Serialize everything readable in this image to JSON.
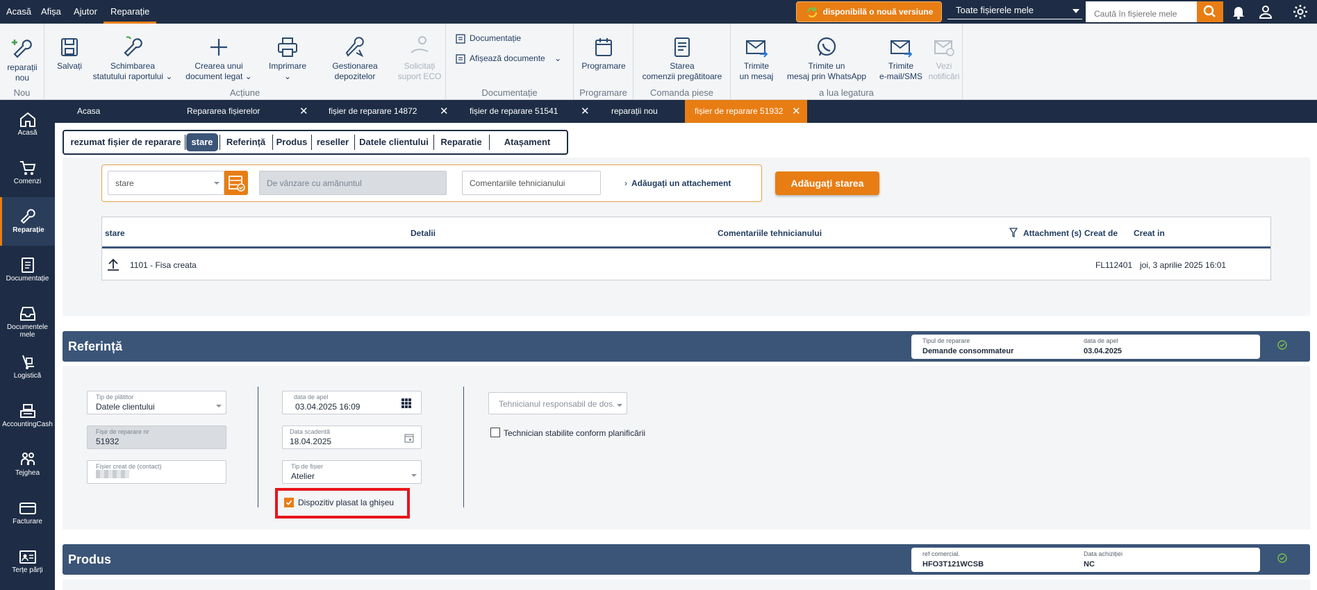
{
  "topmenu": {
    "items": [
      "Acasă",
      "Afișa",
      "Ajutor",
      "Reparație"
    ],
    "active": "Reparație",
    "update_label": "disponibilă o nouă versiune",
    "scope_select": "Toate fișierele mele",
    "search_placeholder": "Caută în fișierele mele"
  },
  "ribbon": {
    "nou": {
      "btn": [
        "reparații",
        "nou"
      ],
      "label": "Nou"
    },
    "actiune": {
      "salvati": "Salvați",
      "schimbare": [
        "Schimbarea",
        "statutului raportului"
      ],
      "creare": [
        "Crearea unui",
        "document legat"
      ],
      "imprimare": "Imprimare",
      "gestionare": [
        "Gestionarea",
        "depozitelor"
      ],
      "solicitati": [
        "Solicitați",
        "suport ECO"
      ],
      "label": "Acțiune"
    },
    "documentatie": {
      "btn1": "Documentație",
      "btn2": "Afișează documente",
      "label": "Documentație"
    },
    "programare": {
      "btn": "Programare",
      "label": "Programare"
    },
    "comanda": {
      "btn": [
        "Starea",
        "comenzii pregătitoare"
      ],
      "label": "Comanda piese"
    },
    "legatura": {
      "mesaj": [
        "Trimite",
        "un mesaj"
      ],
      "whatsapp": [
        "Trimite un",
        "mesaj prin WhatsApp"
      ],
      "email": [
        "Trimite",
        "e-mail/SMS"
      ],
      "notificari": [
        "Vezi",
        "notificări"
      ],
      "label": "a lua legatura"
    }
  },
  "leftnav": [
    "Acasă",
    "Comenzi",
    "Reparație",
    "Documentație",
    "Documentele mele",
    "Logistică",
    "AccountingCash",
    "Tejghea",
    "Facturare",
    "Terțe părți"
  ],
  "doctabs": [
    "Acasa",
    "Repararea fișierelor",
    "fișier de reparare 14872",
    "fișier de reparare 51541",
    "reparații nou",
    "fișier de reparare 51932"
  ],
  "subtabs": [
    "rezumat fișier de reparare",
    "stare",
    "Referință",
    "Produs",
    "reseller",
    "Datele clientului",
    "Reparatie",
    "Atașament"
  ],
  "stare": {
    "select_placeholder": "stare",
    "retail_placeholder": "De vânzare cu amănuntul",
    "comments_placeholder": "Comentariile tehnicianului",
    "attach_label": "Adăugați un attachement",
    "add_button": "Adăugați starea",
    "columns": [
      "stare",
      "Detalii",
      "Comentariile tehnicianului",
      "Attachment (s)",
      "Creat de",
      "Creat in"
    ],
    "row": {
      "stare": "1101 - Fisa creata",
      "creat_de": "FL112401",
      "creat_in": "joi, 3 aprilie 2025 16:01"
    }
  },
  "referinta": {
    "title": "Referință",
    "card": {
      "l1": "Tipul de reparare",
      "v1": "Demande consommateur",
      "l2": "data de apel",
      "v2": "03.04.2025"
    },
    "tip_platitor": {
      "label": "Tip de plătitor",
      "value": "Datele clientului"
    },
    "fisa_nr": {
      "label": "Fișe de reparare nr",
      "value": "51932"
    },
    "fisier_creat": {
      "label": "Fișier creat de (contact)"
    },
    "data_apel": {
      "label": "data de apel",
      "value": "03.04.2025 16:09"
    },
    "data_scadenta": {
      "label": "Data scadentă",
      "value": "18.04.2025"
    },
    "tip_fisier": {
      "label": "Tip de fișier",
      "value": "Atelier"
    },
    "dispozitiv": "Dispozitiv plasat la ghișeu",
    "tehnician_placeholder": "Tehnicianul responsabil de dos...",
    "tehnician_check": "Technician stabilite conform planificării"
  },
  "produs": {
    "title": "Produs",
    "card": {
      "l1": "ref comercial.",
      "v1": "HFO3T121WCSB",
      "l2": "Data achiziției",
      "v2": "NC"
    }
  },
  "colors": {
    "navy": "#1e2d45",
    "orange": "#e87d14",
    "section": "#3b5578",
    "highlight": "#e8141a"
  }
}
